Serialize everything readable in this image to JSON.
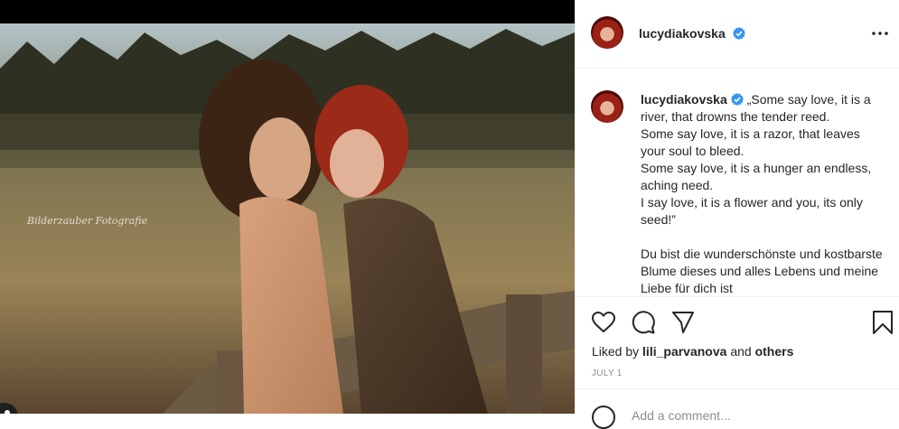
{
  "post": {
    "author": "lucydiakovska",
    "verified": true,
    "photo_watermark": "Bilderzauber Fotografie",
    "caption_text": "„Some say love, it is a river, that drowns the tender reed.\nSome say love, it is a razor, that leaves your soul to bleed.\nSome say love, it is a hunger an endless, aching need.\nI say love, it is a flower and you, its only seed!”\n\nDu bist die wunderschönste und kostbarste Blume dieses und alles Lebens und meine Liebe für dich ist",
    "likes_prefix": "Liked by ",
    "liked_by_user": "lili_parvanova",
    "likes_and": " and ",
    "likes_others": "others",
    "date": "JULY 1",
    "comment_placeholder": "Add a comment..."
  },
  "icons": {
    "more": "more-options-icon",
    "like": "heart-icon",
    "comment": "comment-icon",
    "share": "share-icon",
    "save": "bookmark-icon",
    "tag": "user-tag-icon",
    "emoji": "emoji-icon",
    "verified": "verified-badge-icon"
  },
  "colors": {
    "verified_blue": "#3897f0",
    "text": "#262626",
    "muted": "#8e8e8e"
  }
}
